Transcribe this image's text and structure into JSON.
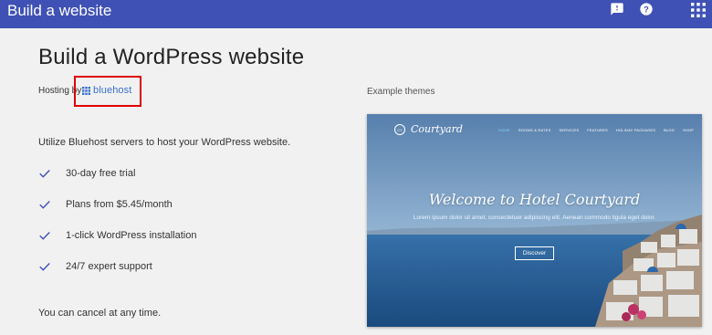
{
  "topbar": {
    "title": "Build a website",
    "icons": [
      "feedback-icon",
      "help-icon",
      "apps-grid-icon"
    ],
    "color": "#3f51b5"
  },
  "main": {
    "page_title": "Build a WordPress website",
    "hosting_by": "Hosting by",
    "host_name": "bluehost",
    "intro": "Utilize Bluehost servers to host your WordPress website.",
    "features": [
      "30-day free trial",
      "Plans from $5.45/month",
      "1-click WordPress installation",
      "24/7 expert support"
    ],
    "cancel_note": "You can cancel at any time."
  },
  "themes": {
    "label": "Example themes",
    "preview": {
      "logo_badge": "CY",
      "logo": "Courtyard",
      "nav": [
        "HOME",
        "ROOMS & RATES",
        "SERVICES",
        "FEATURES",
        "HOLIDAY PACKAGES",
        "BLOG",
        "SHOP"
      ],
      "heading": "Welcome to Hotel Courtyard",
      "subheading": "Lorem ipsum dolor sit amet, consectetuer adipiscing elit. Aenean commodo ligula eget dolor.",
      "button": "Discover"
    }
  },
  "colors": {
    "accent": "#3f51b5",
    "highlight_box": "#e00000",
    "bluehost_blue": "#3b6fcf",
    "check": "#3f51b5"
  }
}
